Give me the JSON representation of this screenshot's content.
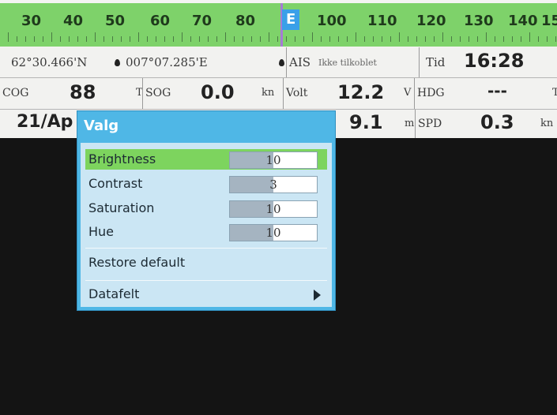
{
  "compass": {
    "numbers": [
      "30",
      "40",
      "50",
      "60",
      "70",
      "80",
      "E",
      "100",
      "110",
      "120",
      "130",
      "140",
      "15"
    ]
  },
  "row1": {
    "lat": "62°30.466'N",
    "lon": "007°07.285'E",
    "ais_label": "AIS",
    "ais_status": "Ikke tilkoblet",
    "time_label": "Tid",
    "time_value": "16:28"
  },
  "row2": {
    "cog_label": "COG",
    "cog_value": "88",
    "cog_unit": "T",
    "sog_label": "SOG",
    "sog_value": "0.0",
    "sog_unit": "kn",
    "volt_label": "Volt",
    "volt_value": "12.2",
    "volt_unit": "V",
    "hdg_label": "HDG",
    "hdg_value": "---",
    "hdg_unit": "T"
  },
  "row3": {
    "date_value": "21/Ap",
    "depth_value": "9.1",
    "depth_unit": "m",
    "spd_label": "SPD",
    "spd_value": "0.3",
    "spd_unit": "kn"
  },
  "menu": {
    "title": "Valg",
    "items": [
      {
        "label": "Brightness",
        "value": "10",
        "level": 0.5
      },
      {
        "label": "Contrast",
        "value": "3",
        "level": 0.5
      },
      {
        "label": "Saturation",
        "value": "10",
        "level": 0.5
      },
      {
        "label": "Hue",
        "value": "10",
        "level": 0.5
      }
    ],
    "restore_label": "Restore default",
    "datafelt_label": "Datafelt"
  },
  "colors": {
    "compass_bg": "#7ed26a",
    "menu_frame": "#4fb7e6",
    "menu_body": "#cbe6f4",
    "selected_row": "#7dd45e",
    "heading_marker": "#3aa0e8"
  }
}
